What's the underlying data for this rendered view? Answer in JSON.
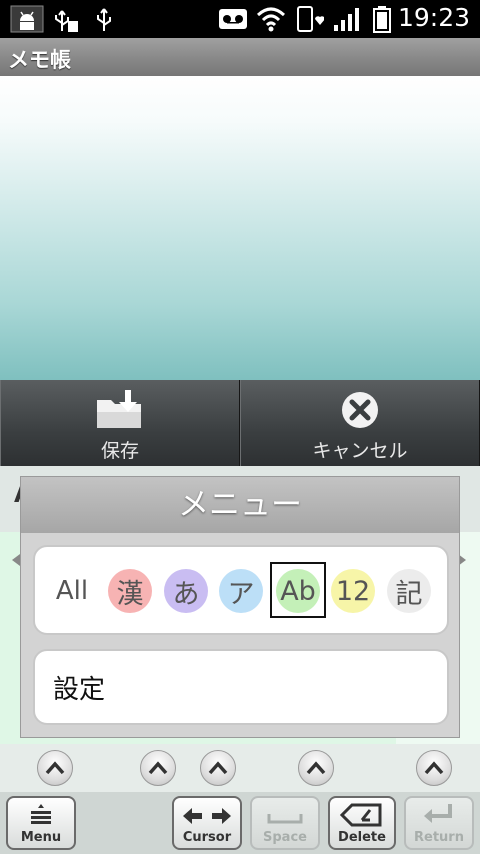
{
  "status": {
    "time": "19:23",
    "icons": [
      "android-debug-icon",
      "usb-sd-icon",
      "usb-icon",
      "voicemail-icon",
      "wifi-icon",
      "phone-heart-icon",
      "signal-icon",
      "battery-icon"
    ]
  },
  "app": {
    "title": "メモ帳"
  },
  "actions": {
    "save_label": "保存",
    "cancel_label": "キャンセル"
  },
  "keyboard": {
    "partial_key": "A",
    "bottom_keys": {
      "menu": "Menu",
      "cursor": "Cursor",
      "space": "Space",
      "delete": "Delete",
      "return": "Return"
    }
  },
  "menu_dialog": {
    "title": "メニュー",
    "modes": [
      {
        "label": "All",
        "color": ""
      },
      {
        "label": "漢",
        "color": "#f7b3b3"
      },
      {
        "label": "あ",
        "color": "#c9bdf2"
      },
      {
        "label": "ア",
        "color": "#bcdff7"
      },
      {
        "label": "Ab",
        "color": "#c4f0b8"
      },
      {
        "label": "12",
        "color": "#f7f5a8"
      },
      {
        "label": "記",
        "color": "#ececec"
      }
    ],
    "selected_mode": "Ab",
    "settings_label": "設定"
  }
}
